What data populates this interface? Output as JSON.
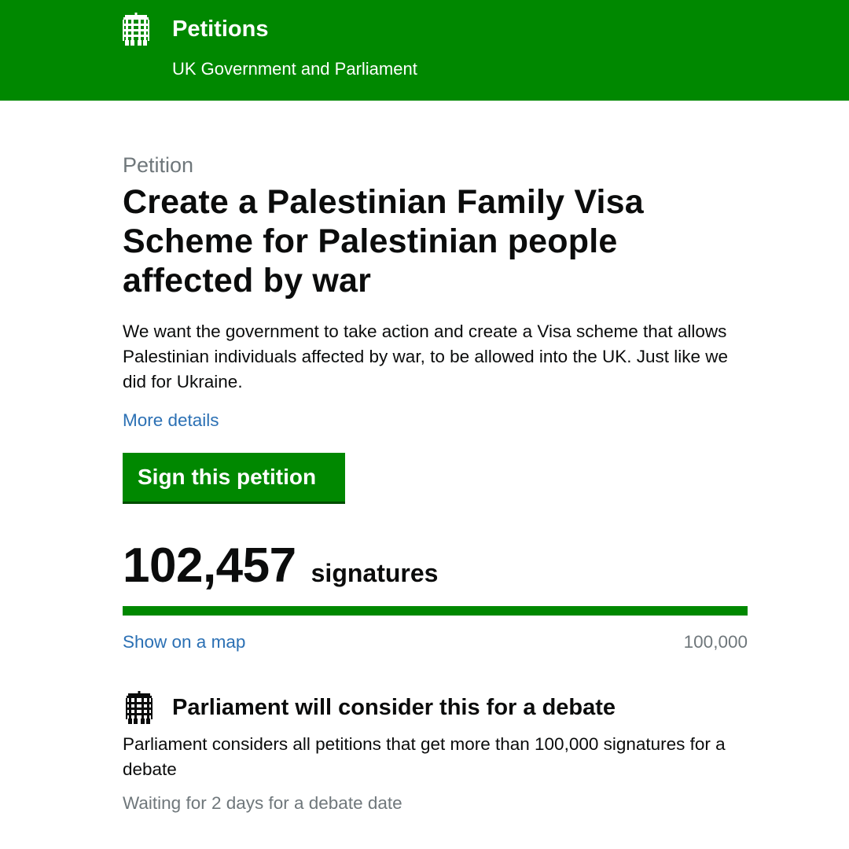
{
  "header": {
    "title": "Petitions",
    "subtitle": "UK Government and Parliament",
    "logo_icon": "portcullis-icon"
  },
  "petition": {
    "caption": "Petition",
    "title": "Create a Palestinian Family Visa Scheme for Palestinian people affected by war",
    "summary": "We want the government to take action and create a Visa scheme that allows Palestinian individuals affected by war, to be allowed into the UK. Just like we did for Ukraine.",
    "more_details_label": "More details",
    "sign_button_label": "Sign this petition"
  },
  "signatures": {
    "count": "102,457",
    "label": "signatures",
    "progress_fraction": 1.0,
    "show_map_label": "Show on a map",
    "threshold": "100,000"
  },
  "debate": {
    "icon": "portcullis-icon",
    "title": "Parliament will consider this for a debate",
    "text": "Parliament considers all petitions that get more than 100,000 signatures for a debate",
    "status": "Waiting for 2 days for a debate date"
  },
  "colors": {
    "brand_green": "#008800",
    "link_blue": "#2b70b4",
    "secondary_text": "#6f777b"
  }
}
